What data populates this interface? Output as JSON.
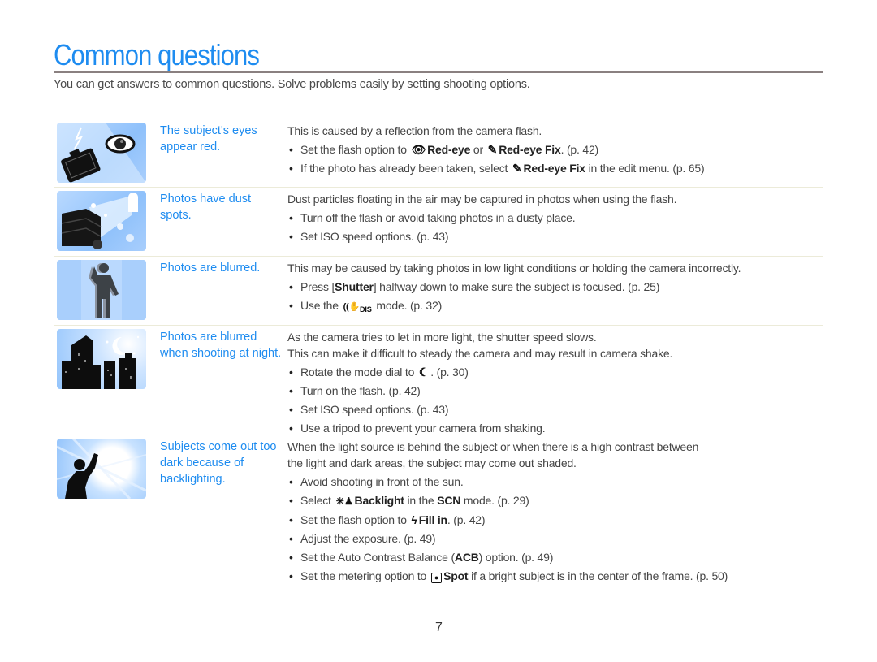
{
  "page": {
    "title": "Common questions",
    "intro": "You can get answers to common questions. Solve problems easily by setting shooting options.",
    "page_number": "7",
    "accent_color": "#1e8cf0"
  },
  "questions": [
    {
      "image": "red-eye-camera-illustration",
      "question": "The subject's eyes appear red.",
      "answer_lines": [
        "This is caused by a reflection from the camera flash."
      ],
      "bullets": [
        {
          "pre": "Set the flash option to",
          "icon1": "red-eye-icon",
          "bold1": "Red-eye",
          "mid": "or",
          "icon2": "red-eye-fix-icon",
          "bold2": "Red-eye Fix",
          "post": ". (p. 42)"
        },
        {
          "pre": "If the photo has already been taken, select",
          "icon1": "red-eye-fix-icon",
          "bold1": "Red-eye Fix",
          "post": "in the edit menu. (p. 65)"
        }
      ]
    },
    {
      "image": "dust-spots-illustration",
      "question": "Photos have dust spots.",
      "answer_lines": [
        "Dust particles floating in the air may be captured in photos when using the flash."
      ],
      "bullets": [
        {
          "pre": "Turn off the flash or avoid taking photos in a dusty place."
        },
        {
          "pre": "Set ISO speed options. (p. 43)"
        }
      ]
    },
    {
      "image": "blurred-person-illustration",
      "question": "Photos are blurred.",
      "answer_lines": [
        "This may be caused by taking photos in low light conditions or holding the camera incorrectly."
      ],
      "bullets": [
        {
          "pre": "Press [",
          "bold1": "Shutter",
          "post": "] halfway down to make sure the subject is focused. (p. 25)"
        },
        {
          "pre": "Use the",
          "icon1": "dual-is-mode-icon",
          "post": "mode. (p. 32)"
        }
      ]
    },
    {
      "image": "night-city-illustration",
      "question": "Photos are blurred when shooting at night.",
      "answer_lines": [
        "As the camera tries to let in more light, the shutter speed slows.",
        "This can make it difficult to steady the camera and may result in camera shake."
      ],
      "bullets": [
        {
          "pre": "Rotate the mode dial to",
          "icon1": "night-mode-icon",
          "post": ". (p. 30)"
        },
        {
          "pre": "Turn on the flash. (p. 42)"
        },
        {
          "pre": "Set ISO speed options. (p. 43)"
        },
        {
          "pre": "Use a tripod to prevent your camera from shaking."
        }
      ]
    },
    {
      "image": "backlit-person-illustration",
      "question": "Subjects come out too dark because of backlighting.",
      "answer_lines": [
        "When the light source is behind the subject or when there is a high contrast between",
        "the light and dark areas, the subject may come out shaded."
      ],
      "bullets": [
        {
          "pre": "Avoid shooting in front of the sun."
        },
        {
          "pre": "Select",
          "icon1": "backlight-icon",
          "bold1": "Backlight",
          "mid": "in the",
          "bold2": "SCN",
          "post": "mode. (p. 29)"
        },
        {
          "pre": "Set the flash option to",
          "icon1": "fill-in-flash-icon",
          "bold1": "Fill in",
          "post": ". (p. 42)"
        },
        {
          "pre": "Adjust the exposure. (p. 49)"
        },
        {
          "pre": "Set the Auto Contrast Balance (",
          "bold1": "ACB",
          "post": ") option. (p. 49)"
        },
        {
          "pre": "Set the metering option to",
          "icon1": "spot-metering-icon",
          "bold1": "Spot",
          "post": "if a bright subject is in the center of the frame. (p. 50)"
        }
      ]
    }
  ]
}
